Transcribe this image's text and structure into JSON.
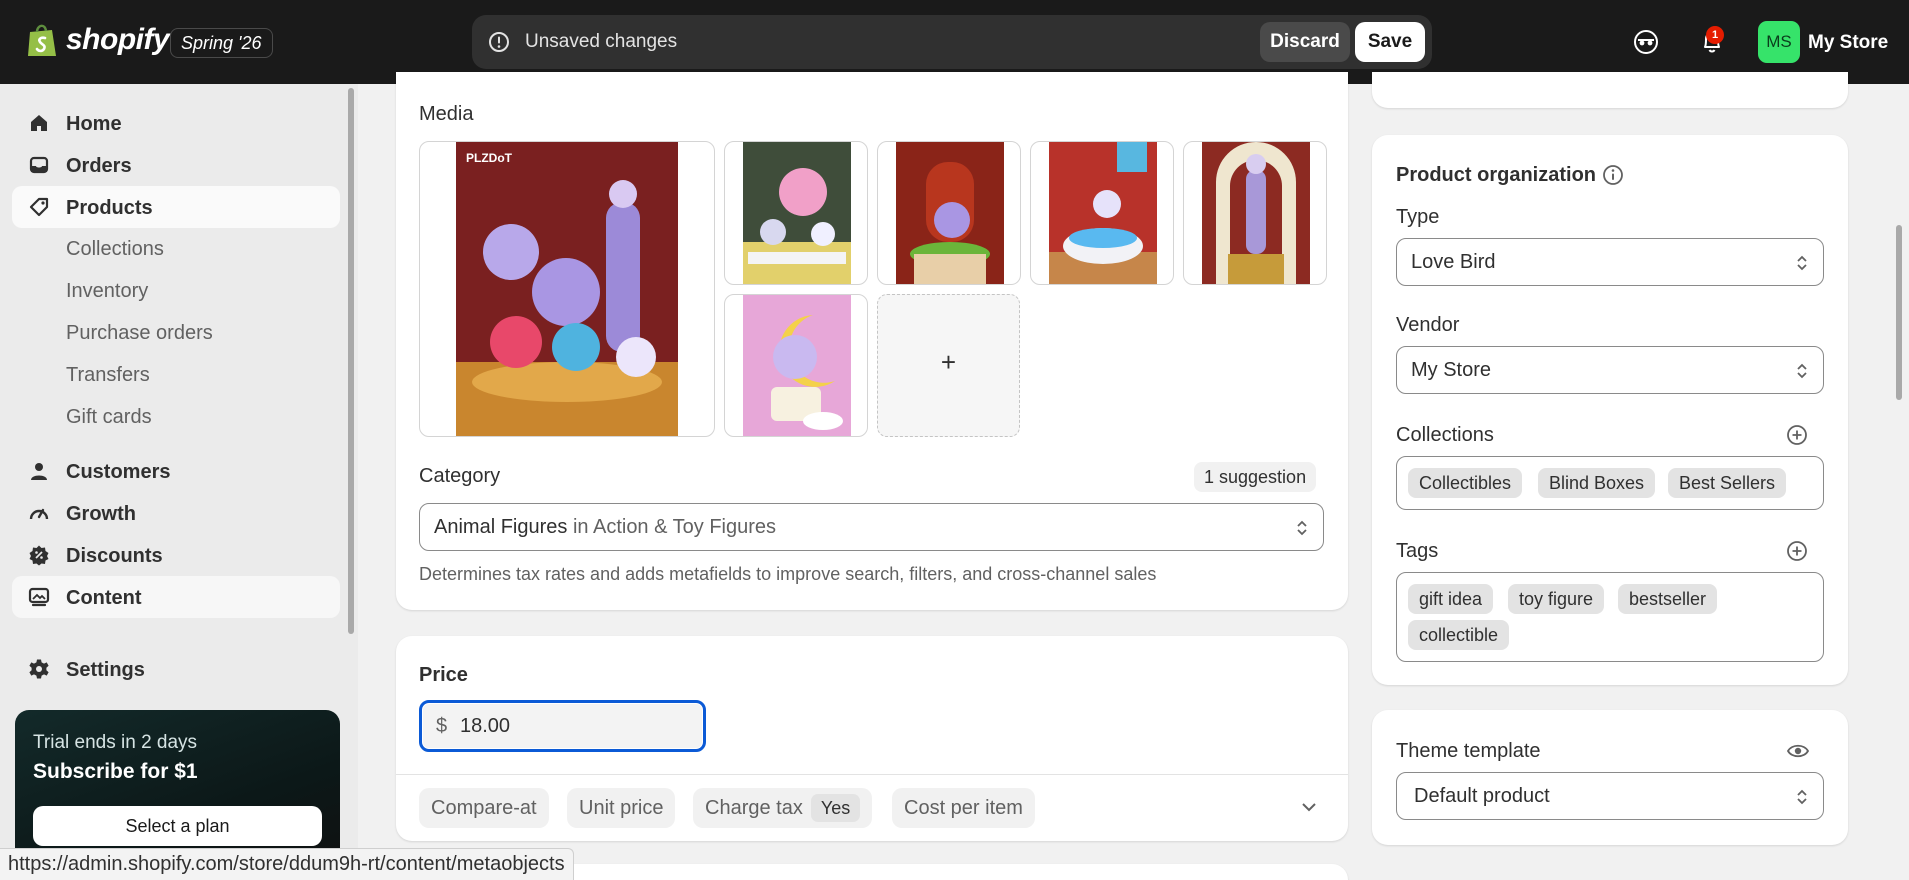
{
  "app": {
    "logo_text": "shopify",
    "edition": "Spring '26",
    "unsaved_message": "Unsaved changes",
    "discard_label": "Discard",
    "save_label": "Save",
    "notification_count": "1",
    "avatar_initials": "MS",
    "store_name": "My Store"
  },
  "sidebar": {
    "items": [
      {
        "label": "Home",
        "icon": "home-icon"
      },
      {
        "label": "Orders",
        "icon": "inbox-icon"
      },
      {
        "label": "Products",
        "icon": "tag-icon"
      },
      {
        "label": "Customers",
        "icon": "person-icon"
      },
      {
        "label": "Growth",
        "icon": "gauge-icon"
      },
      {
        "label": "Discounts",
        "icon": "discount-icon"
      },
      {
        "label": "Content",
        "icon": "image-icon"
      },
      {
        "label": "Settings",
        "icon": "gear-icon"
      }
    ],
    "product_subitems": [
      "Collections",
      "Inventory",
      "Purchase orders",
      "Transfers",
      "Gift cards"
    ],
    "trial": {
      "line1": "Trial ends in 2 days",
      "line2": "Subscribe for $1",
      "button": "Select a plan"
    }
  },
  "main": {
    "media_label": "Media",
    "add_media_symbol": "+",
    "category_label": "Category",
    "category_suggestion": "1 suggestion",
    "category_value": "Animal Figures",
    "category_context": "in Action & Toy Figures",
    "category_hint": "Determines tax rates and adds metafields to improve search, filters, and cross-channel sales",
    "price_label": "Price",
    "price_currency": "$",
    "price_value": "18.00",
    "pricing_chips": {
      "compare_at": "Compare-at",
      "unit_price": "Unit price",
      "charge_tax": "Charge tax",
      "charge_tax_value": "Yes",
      "cost_per_item": "Cost per item"
    }
  },
  "organization": {
    "title": "Product organization",
    "type_label": "Type",
    "type_value": "Love Bird",
    "vendor_label": "Vendor",
    "vendor_value": "My Store",
    "collections_label": "Collections",
    "collections": [
      "Collectibles",
      "Blind Boxes",
      "Best Sellers"
    ],
    "tags_label": "Tags",
    "tags": [
      "gift idea",
      "toy figure",
      "bestseller",
      "collectible"
    ]
  },
  "theme": {
    "label": "Theme template",
    "value": "Default product"
  },
  "status_bar_url": "https://admin.shopify.com/store/ddum9h-rt/content/metaobjects",
  "colors": {
    "topbar": "#1a1a1a",
    "accent_focus": "#0b5ad6",
    "avatar": "#36e36a",
    "badge": "#e51c00"
  }
}
